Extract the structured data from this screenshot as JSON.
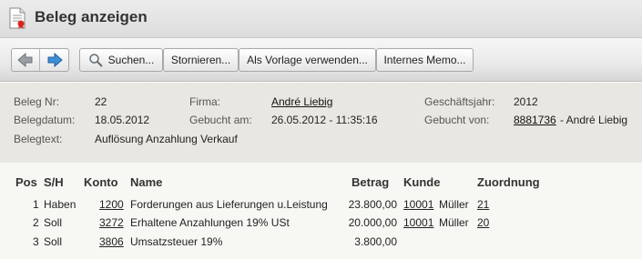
{
  "window": {
    "title": "Beleg anzeigen"
  },
  "toolbar": {
    "search_label": "Suchen...",
    "cancel_label": "Stornieren...",
    "template_label": "Als Vorlage verwenden...",
    "memo_label": "Internes Memo..."
  },
  "header": {
    "beleg_nr_label": "Beleg Nr:",
    "beleg_nr": "22",
    "belegdatum_label": "Belegdatum:",
    "belegdatum": "18.05.2012",
    "belegtext_label": "Belegtext:",
    "belegtext": "Auflösung Anzahlung Verkauf",
    "firma_label": "Firma:",
    "firma": "André Liebig",
    "gebucht_am_label": "Gebucht am:",
    "gebucht_am": "26.05.2012 - 11:35:16",
    "geschaeftsjahr_label": "Geschäftsjahr:",
    "geschaeftsjahr": "2012",
    "gebucht_von_label": "Gebucht von:",
    "gebucht_von_id": "8881736",
    "gebucht_von_name": "- André Liebig"
  },
  "table": {
    "columns": {
      "pos": "Pos",
      "sh": "S/H",
      "konto": "Konto",
      "name": "Name",
      "betrag": "Betrag",
      "kunde": "Kunde",
      "zuordnung": "Zuordnung"
    },
    "rows": [
      {
        "pos": "1",
        "sh": "Haben",
        "konto": "1200",
        "name": "Forderungen aus Lieferungen u.Leistung",
        "betrag": "23.800,00",
        "kunde_nr": "10001",
        "kunde_name": "Müller",
        "zuordnung": "21"
      },
      {
        "pos": "2",
        "sh": "Soll",
        "konto": "3272",
        "name": "Erhaltene Anzahlungen 19% USt",
        "betrag": "20.000,00",
        "kunde_nr": "10001",
        "kunde_name": "Müller",
        "zuordnung": "20"
      },
      {
        "pos": "3",
        "sh": "Soll",
        "konto": "3806",
        "name": "Umsatzsteuer 19%",
        "betrag": "3.800,00",
        "kunde_nr": "",
        "kunde_name": "",
        "zuordnung": ""
      }
    ]
  }
}
